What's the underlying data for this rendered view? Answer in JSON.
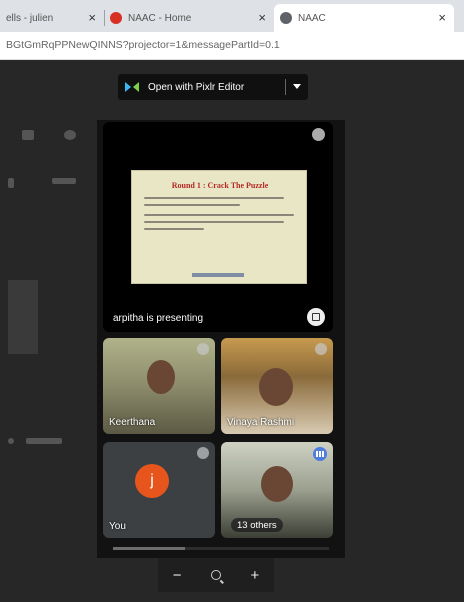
{
  "browser": {
    "tabs": [
      {
        "label": "ells - julien",
        "favicon": "doc-icon"
      },
      {
        "label": "NAAC - Home",
        "favicon": "red-logo-icon"
      },
      {
        "label": "NAAC",
        "favicon": "globe-icon"
      }
    ],
    "close_glyph": "×",
    "url": "BGtGmRqPPNewQINNS?projector=1&messagePartId=0.1"
  },
  "viewer": {
    "open_with_label": "Open with Pixlr Editor",
    "zoom_out": "−",
    "zoom_in": "+"
  },
  "meet": {
    "presenter_label": "arpitha is presenting",
    "slide_title": "Round 1 : Crack The Puzzle",
    "participants": [
      {
        "name": "Keerthana"
      },
      {
        "name": "Vinaya Rashmi"
      },
      {
        "name": "You",
        "avatar_letter": "j",
        "avatar_color": "#e8551c"
      },
      {
        "name": "13 others"
      }
    ]
  },
  "colors": {
    "app_background": "#272727",
    "panel_background": "#121212",
    "accent_blue": "#4f7ddf"
  }
}
